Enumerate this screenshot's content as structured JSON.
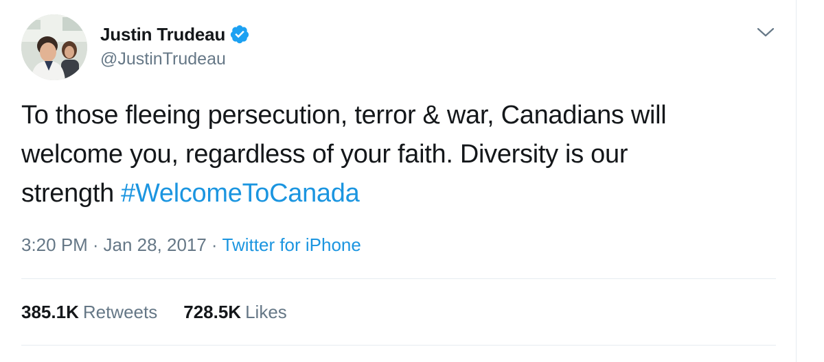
{
  "author": {
    "display_name": "Justin Trudeau",
    "handle": "@JustinTrudeau",
    "verified": true,
    "avatar_icon": "profile-photo"
  },
  "tweet": {
    "text_line1": "To those fleeing persecution, terror & war, Canadians will",
    "text_line2": "welcome you, regardless of your faith. Diversity is our",
    "text_line3": "strength ",
    "hashtag": "#WelcomeToCanada"
  },
  "meta": {
    "time": "3:20 PM",
    "separator": "·",
    "date": "Jan 28, 2017",
    "source": "Twitter for iPhone"
  },
  "stats": {
    "retweets_count": "385.1K",
    "retweets_label": "Retweets",
    "likes_count": "728.5K",
    "likes_label": "Likes"
  },
  "colors": {
    "link_blue": "#1b95e0",
    "verified_blue": "#1da1f2",
    "secondary_text": "#657786",
    "primary_text": "#14171a",
    "divider": "#e6ecf0"
  }
}
